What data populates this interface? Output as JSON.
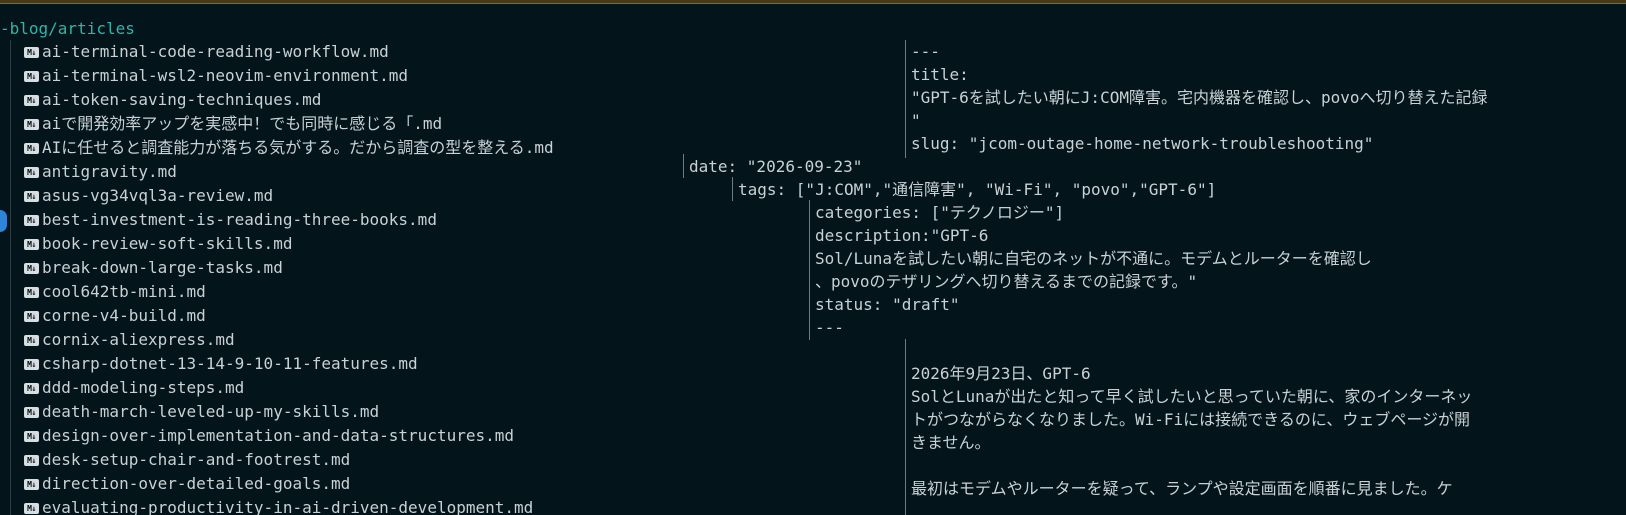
{
  "path": "-blog/articles",
  "icons": {
    "markdown": "markdown-file-icon",
    "markdown_glyph": "M↓"
  },
  "files": [
    "ai-terminal-code-reading-workflow.md",
    "ai-terminal-wsl2-neovim-environment.md",
    "ai-token-saving-techniques.md",
    "aiで開発効率アップを実感中！でも同時に感じる「.md",
    "AIに任せると調査能力が落ちる気がする。だから調査の型を整える.md",
    "antigravity.md",
    "asus-vg34vql3a-review.md",
    "best-investment-is-reading-three-books.md",
    "book-review-soft-skills.md",
    "break-down-large-tasks.md",
    "cool642tb-mini.md",
    "corne-v4-build.md",
    "cornix-aliexpress.md",
    "csharp-dotnet-13-14-9-10-11-features.md",
    "ddd-modeling-steps.md",
    "death-march-leveled-up-my-skills.md",
    "design-over-implementation-and-data-structures.md",
    "desk-setup-chair-and-footrest.md",
    "direction-over-detailed-goals.md",
    "evaluating-productivity-in-ai-driven-development.md"
  ],
  "preview": {
    "l0": "---",
    "l1": "title:",
    "l2": "\"GPT-6を試したい朝にJ:COM障害。宅内機器を確認し、povoへ切り替えた記録",
    "l3": "\"",
    "l4": "slug: \"jcom-outage-home-network-troubleshooting\"",
    "l5": "date: \"2026-09-23\"",
    "l6": "tags: [\"J:COM\",\"通信障害\", \"Wi-Fi\", \"povo\",\"GPT-6\"]",
    "l7": "categories: [\"テクノロジー\"]",
    "l8": "description:\"GPT-6",
    "l9": "Sol/Lunaを試したい朝に自宅のネットが不通に。モデムとルーターを確認し",
    "l10": "、povoのテザリングへ切り替えるまでの記録です。\"",
    "l11": "status: \"draft\"",
    "l12": "---",
    "l13": "",
    "l14": "2026年9月23日、GPT-6",
    "l15": "SolとLunaが出たと知って早く試したいと思っていた朝に、家のインターネッ",
    "l16": "トがつながらなくなりました。Wi-Fiには接続できるのに、ウェブページが開",
    "l17": "きません。",
    "l18": "",
    "l19": "最初はモデムやルーターを疑って、ランプや設定画面を順番に見ました。ケ"
  }
}
